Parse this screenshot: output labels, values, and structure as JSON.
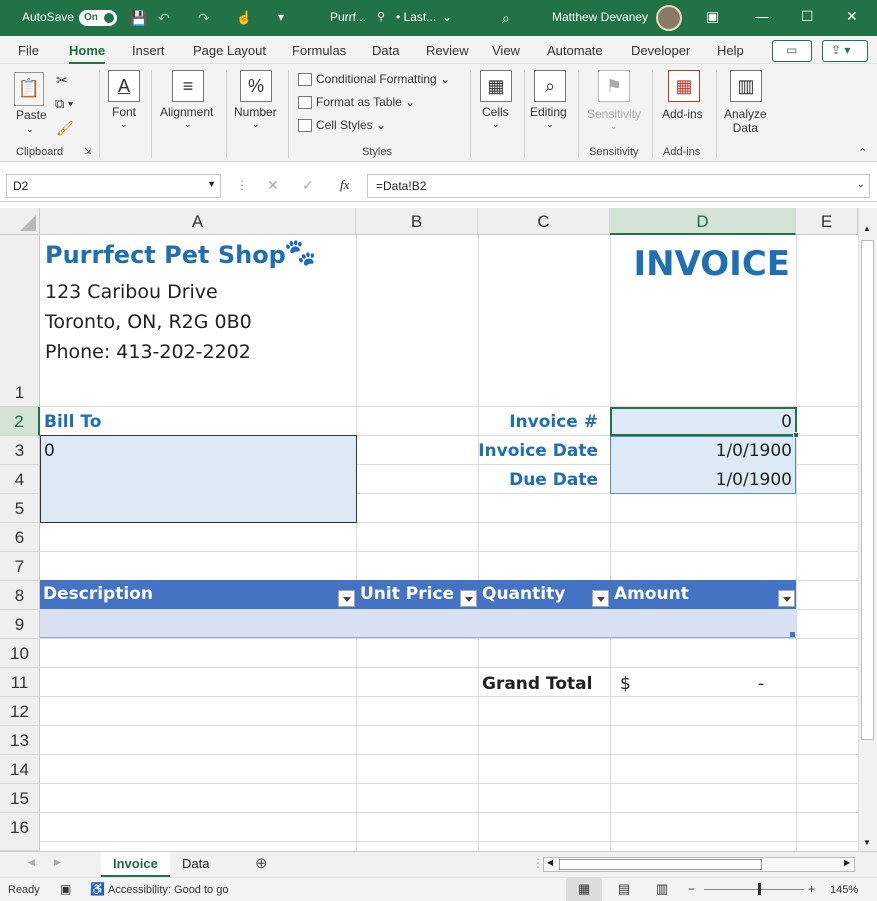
{
  "titlebar": {
    "autosave_label": "AutoSave",
    "toggle_state": "On",
    "filename": "Purrf...",
    "save_status": "• Last...",
    "user_name": "Matthew Devaney"
  },
  "menu": {
    "tabs": [
      "File",
      "Home",
      "Insert",
      "Page Layout",
      "Formulas",
      "Data",
      "Review",
      "View",
      "Automate",
      "Developer",
      "Help"
    ],
    "active": "Home"
  },
  "ribbon": {
    "paste": "Paste",
    "font": "Font",
    "alignment": "Alignment",
    "number": "Number",
    "cond_format": "Conditional Formatting",
    "format_table": "Format as Table",
    "cell_styles": "Cell Styles",
    "cells": "Cells",
    "editing": "Editing",
    "sensitivity": "Sensitivity",
    "addins": "Add-ins",
    "analyze_l1": "Analyze",
    "analyze_l2": "Data",
    "group_clipboard": "Clipboard",
    "group_styles": "Styles",
    "group_sensitivity": "Sensitivity",
    "group_addins": "Add-ins"
  },
  "formula_bar": {
    "name_box": "D2",
    "formula": "=Data!B2"
  },
  "grid": {
    "columns": [
      "A",
      "B",
      "C",
      "D",
      "E"
    ],
    "selected_column": "D",
    "rows": [
      "1",
      "2",
      "3",
      "4",
      "5",
      "6",
      "7",
      "8",
      "9",
      "10",
      "11",
      "12",
      "13",
      "14",
      "15",
      "16"
    ],
    "selected_row": "2"
  },
  "invoice": {
    "shop_name": "Purrfect Pet Shop",
    "address1": "123 Caribou Drive",
    "address2": "Toronto, ON, R2G 0B0",
    "phone": "Phone: 413-202-2202",
    "title": "INVOICE",
    "bill_to_label": "Bill To",
    "bill_to_value": "0",
    "invoice_no_label": "Invoice #",
    "invoice_no_value": "0",
    "invoice_date_label": "Invoice Date",
    "invoice_date_value": "1/0/1900",
    "due_date_label": "Due Date",
    "due_date_value": "1/0/1900",
    "table_headers": [
      "Description",
      "Unit Price",
      "Quantity",
      "Amount"
    ],
    "grand_total_label": "Grand Total",
    "grand_total_currency": "$",
    "grand_total_value": "-"
  },
  "sheets": {
    "tabs": [
      "Invoice",
      "Data"
    ],
    "active": "Invoice"
  },
  "statusbar": {
    "ready": "Ready",
    "accessibility": "Accessibility: Good to go",
    "zoom": "145%"
  },
  "colors": {
    "excel_green": "#217346",
    "header_blue": "#1f6fb4",
    "table_header": "#4472c4",
    "input_fill": "#dde9f5"
  }
}
